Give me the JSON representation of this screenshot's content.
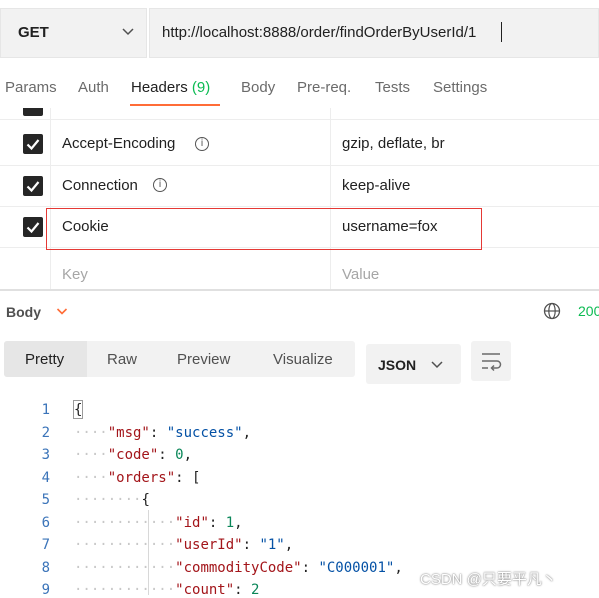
{
  "request": {
    "method": "GET",
    "url": "http://localhost:8888/order/findOrderByUserId/1"
  },
  "tabs": [
    {
      "label": "Params"
    },
    {
      "label": "Auth"
    },
    {
      "label": "Headers",
      "count": "(9)"
    },
    {
      "label": "Body"
    },
    {
      "label": "Pre-req."
    },
    {
      "label": "Tests"
    },
    {
      "label": "Settings"
    }
  ],
  "headers": {
    "rows": [
      {
        "key": "Accept-Encoding",
        "value": "gzip, deflate, br",
        "checked": true,
        "has_info": true
      },
      {
        "key": "Connection",
        "value": "keep-alive",
        "checked": true,
        "has_info": true
      },
      {
        "key": "Cookie",
        "value": "username=fox",
        "checked": true,
        "has_info": false
      }
    ],
    "key_placeholder": "Key",
    "value_placeholder": "Value"
  },
  "response": {
    "body_label": "Body",
    "status": "200",
    "view_tabs": [
      "Pretty",
      "Raw",
      "Preview",
      "Visualize"
    ],
    "format": "JSON"
  },
  "code": {
    "line_numbers": [
      "1",
      "2",
      "3",
      "4",
      "5",
      "6",
      "7",
      "8",
      "9"
    ],
    "l1": "{",
    "l2_key": "\"msg\"",
    "l2_val": "\"success\"",
    "l3_key": "\"code\"",
    "l3_val": "0",
    "l4_key": "\"orders\"",
    "l4_rest": ": [",
    "l5": "{",
    "l6_key": "\"id\"",
    "l6_val": "1",
    "l7_key": "\"userId\"",
    "l7_val": "\"1\"",
    "l8_key": "\"commodityCode\"",
    "l8_val": "\"C000001\"",
    "l9_key": "\"count\"",
    "l9_val": "2"
  },
  "watermark": "CSDN @只要平凡丶"
}
